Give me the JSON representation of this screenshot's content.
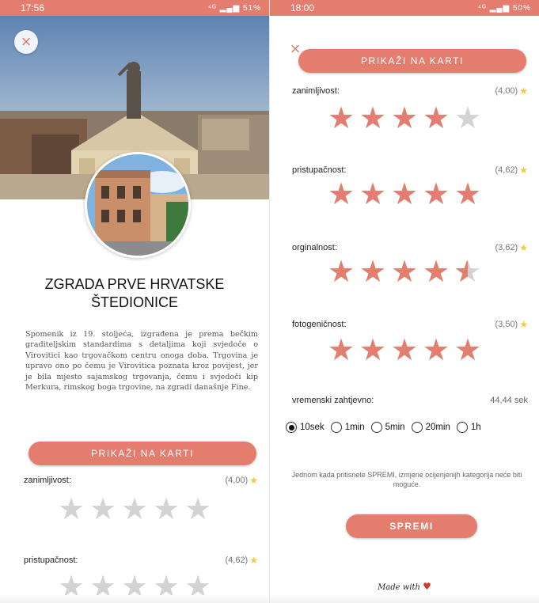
{
  "left": {
    "status": {
      "time": "17:56",
      "icons": "⁴ᴳ ▂▄▆ 51%"
    },
    "close_glyph": "×",
    "title_line1": "ZGRADA PRVE HRVATSKE",
    "title_line2": "ŠTEDIONICE",
    "description": "Spomenik iz 19. stoljeća, izgrađena je prema bečkim graditeljskim standardima s detaljima koji svjedoče o Virovitici kao trgovačkom centru onoga doba. Trgovina je upravo ono po čemu je Virovitica poznata kroz povijest, jer je bila mjesto sajamskog trgovanja, čemu i svjedoči kip Merkura, rimskog boga trgovine, na zgradi današnje Fine.",
    "map_button": "PRIKAŽI NA KARTI",
    "ratings": [
      {
        "label": "zanimljivost:",
        "value": "(4,00)",
        "user_stars": 0
      },
      {
        "label": "pristupačnost:",
        "value": "(4,62)",
        "user_stars": 0
      }
    ]
  },
  "right": {
    "status": {
      "time": "18:00",
      "icons": "⁴ᴳ ▂▄▆ 50%"
    },
    "close_glyph": "×",
    "map_button": "PRIKAŽI NA KARTI",
    "ratings": [
      {
        "label": "zanimljivost:",
        "value": "(4,00)",
        "user_stars": 4
      },
      {
        "label": "pristupačnost:",
        "value": "(4,62)",
        "user_stars": 5
      },
      {
        "label": "orginalnost:",
        "value": "(3,62)",
        "user_stars": 4.5
      },
      {
        "label": "fotogeničnost:",
        "value": "(3,50)",
        "user_stars": 5
      }
    ],
    "time_required": {
      "label": "vremenski zahtjevno:",
      "value": "44,44 sek"
    },
    "time_options": [
      {
        "label": "10sek",
        "selected": true
      },
      {
        "label": "1min",
        "selected": false
      },
      {
        "label": "5min",
        "selected": false
      },
      {
        "label": "20min",
        "selected": false
      },
      {
        "label": "1h",
        "selected": false
      }
    ],
    "note": "Jednom kada pritisnete SPREMI, izmjene ocijenjenijh kategorija neće biti moguće.",
    "save_button": "SPREMI",
    "made_with": "Made with"
  },
  "icons": {
    "star": "star-icon",
    "close": "close-icon",
    "heart": "heart-icon"
  },
  "colors": {
    "accent": "#e57d6f",
    "star_empty": "#d3d3d3",
    "star_mini": "#f3c83a"
  }
}
